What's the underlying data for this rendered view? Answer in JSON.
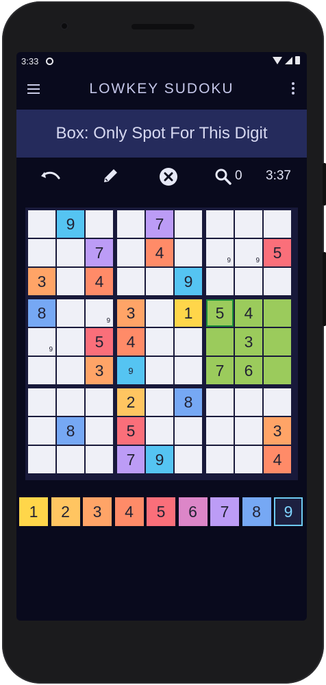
{
  "status_bar": {
    "time": "3:33"
  },
  "app": {
    "title": "LOWKEY SUDOKU"
  },
  "hint": {
    "text": "Box: Only Spot For This Digit"
  },
  "toolbar": {
    "hint_count": "0",
    "timer": "3:37"
  },
  "colors": {
    "1": "#ffd64a",
    "2": "#ffc561",
    "3": "#ffa467",
    "4": "#ff8b68",
    "5": "#fa6f7a",
    "6": "#dc86c8",
    "7": "#bc9cf6",
    "8": "#76a8f4",
    "9": "#55c4f2",
    "empty": "#eff0f7",
    "highlight": "#9bcb5c",
    "board_bg": "#18193a"
  },
  "board": {
    "cells": [
      [
        {
          "v": ""
        },
        {
          "v": "9"
        },
        {
          "v": ""
        },
        {
          "v": ""
        },
        {
          "v": "7"
        },
        {
          "v": ""
        },
        {
          "v": ""
        },
        {
          "v": ""
        },
        {
          "v": ""
        }
      ],
      [
        {
          "v": ""
        },
        {
          "v": ""
        },
        {
          "v": "7"
        },
        {
          "v": ""
        },
        {
          "v": "4"
        },
        {
          "v": ""
        },
        {
          "v": "",
          "note": "9"
        },
        {
          "v": "",
          "note": "9"
        },
        {
          "v": "5"
        }
      ],
      [
        {
          "v": "3"
        },
        {
          "v": ""
        },
        {
          "v": "4"
        },
        {
          "v": ""
        },
        {
          "v": ""
        },
        {
          "v": "9"
        },
        {
          "v": ""
        },
        {
          "v": ""
        },
        {
          "v": ""
        }
      ],
      [
        {
          "v": "8"
        },
        {
          "v": ""
        },
        {
          "v": "",
          "note": "9"
        },
        {
          "v": "3"
        },
        {
          "v": ""
        },
        {
          "v": "1"
        },
        {
          "v": "5",
          "hl": true,
          "sel": true
        },
        {
          "v": "4",
          "hl": true
        },
        {
          "v": "",
          "hl": true
        }
      ],
      [
        {
          "v": "",
          "note": "9"
        },
        {
          "v": ""
        },
        {
          "v": "5"
        },
        {
          "v": "4"
        },
        {
          "v": ""
        },
        {
          "v": ""
        },
        {
          "v": "",
          "hl": true
        },
        {
          "v": "3",
          "hl": true
        },
        {
          "v": "",
          "hl": true
        }
      ],
      [
        {
          "v": ""
        },
        {
          "v": ""
        },
        {
          "v": "3"
        },
        {
          "v": "9",
          "mid": true
        },
        {
          "v": ""
        },
        {
          "v": ""
        },
        {
          "v": "7",
          "hl": true
        },
        {
          "v": "6",
          "hl": true
        },
        {
          "v": "",
          "hl": true
        }
      ],
      [
        {
          "v": ""
        },
        {
          "v": ""
        },
        {
          "v": ""
        },
        {
          "v": "2"
        },
        {
          "v": ""
        },
        {
          "v": "8"
        },
        {
          "v": ""
        },
        {
          "v": ""
        },
        {
          "v": ""
        }
      ],
      [
        {
          "v": ""
        },
        {
          "v": "8"
        },
        {
          "v": ""
        },
        {
          "v": "5"
        },
        {
          "v": ""
        },
        {
          "v": ""
        },
        {
          "v": ""
        },
        {
          "v": ""
        },
        {
          "v": "3"
        }
      ],
      [
        {
          "v": ""
        },
        {
          "v": ""
        },
        {
          "v": ""
        },
        {
          "v": "7"
        },
        {
          "v": "9"
        },
        {
          "v": ""
        },
        {
          "v": ""
        },
        {
          "v": ""
        },
        {
          "v": "4"
        }
      ]
    ]
  },
  "picker": {
    "digits": [
      "1",
      "2",
      "3",
      "4",
      "5",
      "6",
      "7",
      "8",
      "9"
    ],
    "active": "9"
  }
}
